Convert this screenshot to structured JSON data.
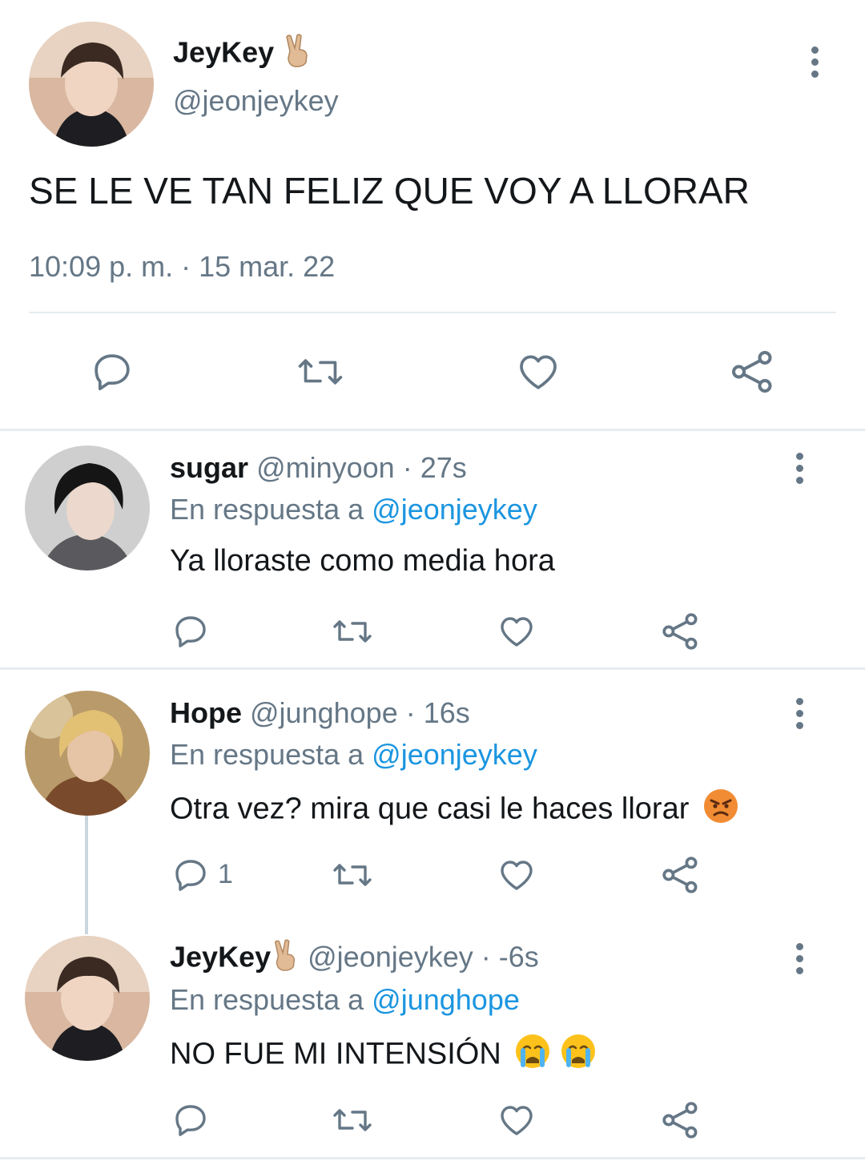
{
  "main_tweet": {
    "display_name": "JeyKey",
    "handle": "@jeonjeykey",
    "text": "SE LE VE TAN FELIZ QUE VOY A LLORAR",
    "timestamp": "10:09 p. m. · 15 mar. 22",
    "name_emoji": "victory-hand-emoji"
  },
  "replies": [
    {
      "display_name": "sugar",
      "handle": "@minyoon",
      "age": "· 27s",
      "reply_prefix": "En respuesta a",
      "reply_to": "@jeonjeykey",
      "text": "Ya lloraste como media hora",
      "reply_count": ""
    },
    {
      "display_name": "Hope",
      "handle": "@junghope",
      "age": "· 16s",
      "reply_prefix": "En respuesta a",
      "reply_to": "@jeonjeykey",
      "text": "Otra vez? mira que casi le haces llorar",
      "text_emoji": "angry-face-emoji",
      "reply_count": "1"
    },
    {
      "display_name": "JeyKey",
      "handle": "@jeonjeykey",
      "age": "· -6s",
      "reply_prefix": "En respuesta a",
      "reply_to": "@junghope",
      "text": "NO FUE MI INTENSIÓN",
      "text_emoji": "crying-face-emoji",
      "reply_count": ""
    }
  ],
  "colors": {
    "text": "#14171a",
    "muted": "#657786",
    "link": "#1b95e0",
    "divider": "#e6ecf0"
  }
}
